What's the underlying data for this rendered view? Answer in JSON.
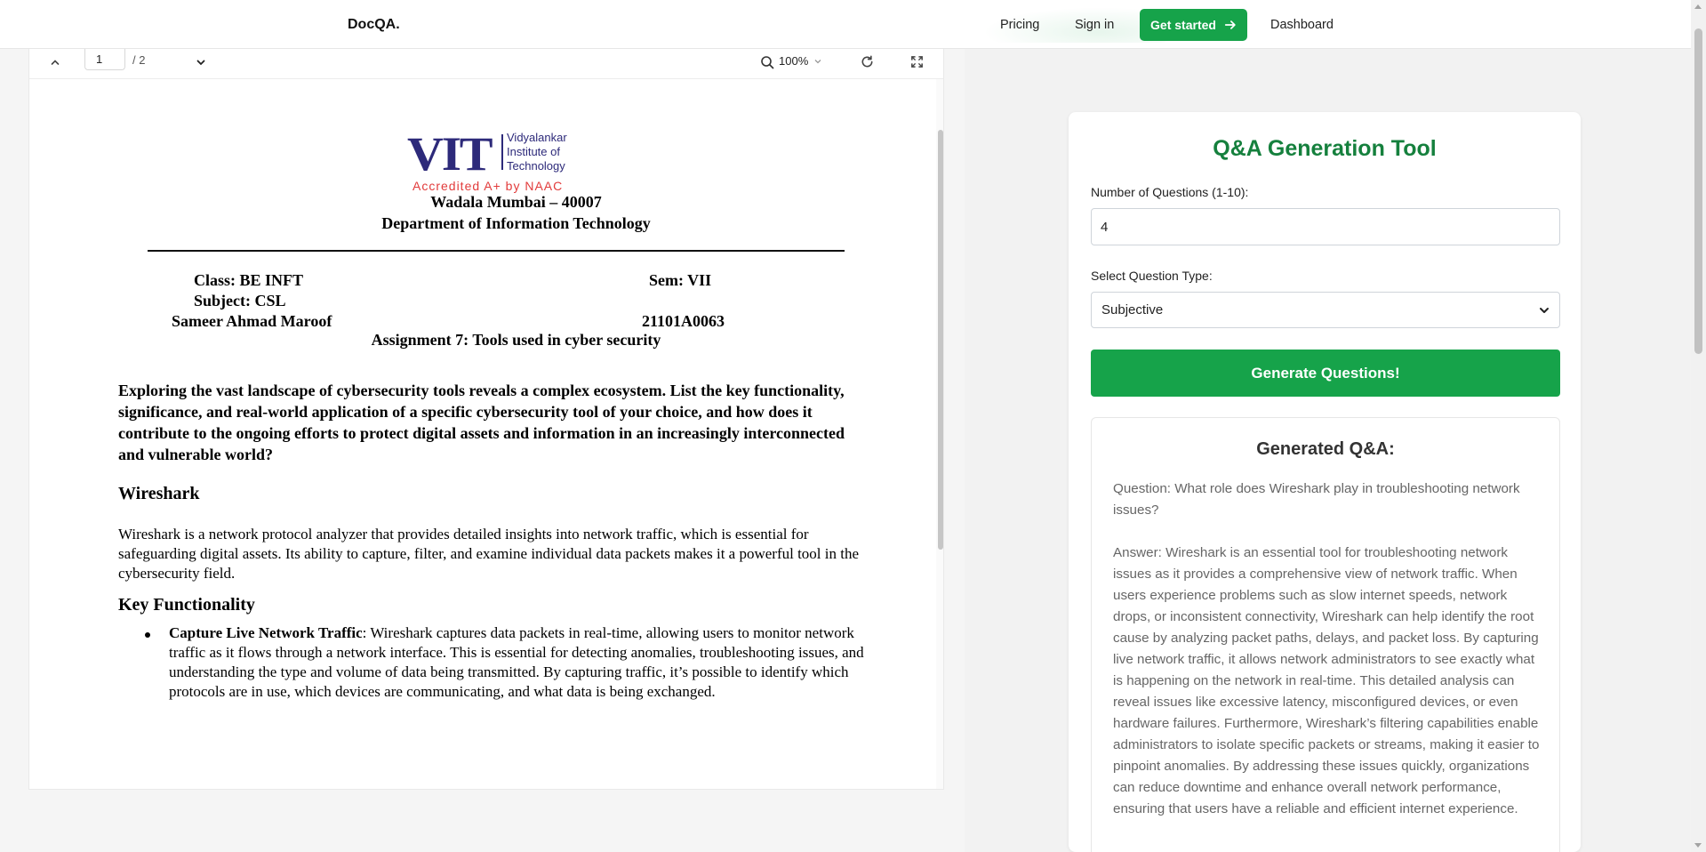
{
  "nav": {
    "brand": "DocQA.",
    "pricing": "Pricing",
    "sign_in": "Sign in",
    "get_started": "Get started",
    "dashboard": "Dashboard",
    "accent": "#16a34a"
  },
  "viewer": {
    "page_current": "1",
    "page_total": "/ 2",
    "zoom": "100%",
    "icons": [
      "chevron-up-icon",
      "chevron-down-icon",
      "search-icon",
      "reload-icon",
      "fullscreen-icon"
    ]
  },
  "document": {
    "logo_text": "VIT",
    "logo_sub": "Vidyalankar Institute of Technology",
    "logo_accreditation": "Accredited A+ by NAAC",
    "address": "Wadala Mumbai – 40007",
    "department": "Department of Information Technology",
    "class": "Class: BE INFT",
    "sem": "Sem: VII",
    "subject": "Subject: CSL",
    "student": "Sameer Ahmad Maroof",
    "roll": "21101A0063",
    "assignment_title": "Assignment 7: Tools used in cyber security",
    "prompt": "Exploring the vast landscape of cybersecurity tools reveals a complex ecosystem. List the key functionality, significance, and real-world application of a specific cybersecurity tool of your choice, and how does it contribute to the ongoing efforts to protect digital assets and information in an increasingly interconnected and vulnerable world?",
    "heading_wireshark": "Wireshark",
    "intro": "Wireshark is a network protocol analyzer that provides detailed insights into network traffic, which is essential for safeguarding digital assets. Its ability to capture, filter, and examine individual data packets makes it a powerful tool in the cybersecurity field.",
    "heading_key": "Key Functionality",
    "bullet_title": "Capture Live Network Traffic",
    "bullet_body": ": Wireshark captures data packets in real-time, allowing users to monitor network traffic as it flows through a network interface. This is essential for detecting anomalies, troubleshooting issues, and understanding the type and volume of data being transmitted. By capturing traffic, it’s possible to identify which protocols are in use, which devices are communicating, and what data is being exchanged."
  },
  "tool": {
    "title": "Q&A Generation Tool",
    "num_label": "Number of Questions (1-10):",
    "num_value": "4",
    "type_label": "Select Question Type:",
    "type_value": "Subjective",
    "generate": "Generate Questions!",
    "output_title": "Generated Q&A:",
    "question": "Question: What role does Wireshark play in troubleshooting network issues?",
    "answer": "Answer: Wireshark is an essential tool for troubleshooting network issues as it provides a comprehensive view of network traffic. When users experience problems such as slow internet speeds, network drops, or inconsistent connectivity, Wireshark can help identify the root cause by analyzing packet paths, delays, and packet loss. By capturing live network traffic, it allows network administrators to see exactly what is happening on the network in real-time. This detailed analysis can reveal issues like excessive latency, misconfigured devices, or even hardware failures. Furthermore, Wireshark’s filtering capabilities enable administrators to isolate specific packets or streams, making it easier to pinpoint anomalies. By addressing these issues quickly, organizations can reduce downtime and enhance overall network performance, ensuring that users have a reliable and efficient internet experience.",
    "title_color": "#15803d"
  }
}
